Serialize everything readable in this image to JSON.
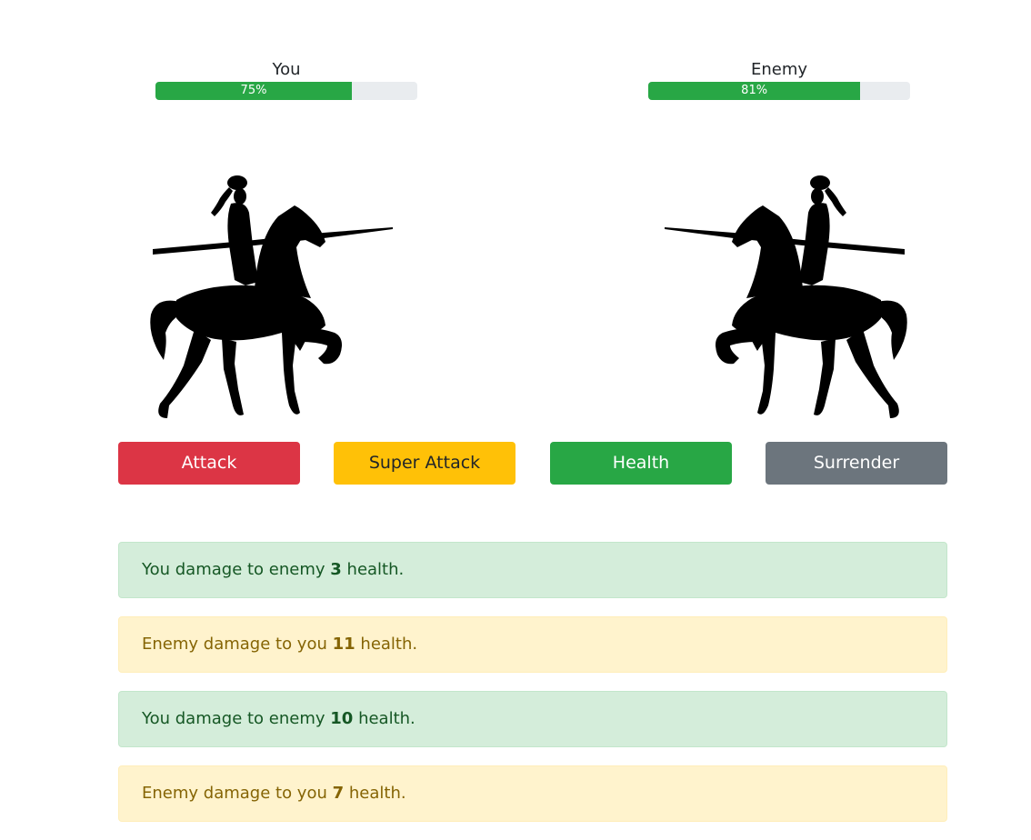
{
  "colors": {
    "bar_fill": "#28a745",
    "bar_track": "#e9ecef",
    "attack": "#dc3545",
    "super_attack": "#ffc107",
    "health": "#28a745",
    "surrender": "#6c757d",
    "log_player_bg": "#d4edda",
    "log_player_border": "#c3e6cb",
    "log_player_text": "#155724",
    "log_enemy_bg": "#fff3cd",
    "log_enemy_border": "#ffeeba",
    "log_enemy_text": "#856404"
  },
  "players": {
    "you": {
      "name": "You",
      "health_percent": 75,
      "health_label": "75%"
    },
    "enemy": {
      "name": "Enemy",
      "health_percent": 81,
      "health_label": "81%"
    }
  },
  "icons": {
    "you": "jousting-knight-icon",
    "enemy": "jousting-knight-icon"
  },
  "controls": {
    "attack": "Attack",
    "super_attack": "Super Attack",
    "health": "Health",
    "surrender": "Surrender"
  },
  "log": [
    {
      "type": "player",
      "prefix": "You damage to enemy",
      "value": "3",
      "suffix": "health."
    },
    {
      "type": "enemy",
      "prefix": "Enemy damage to you",
      "value": "11",
      "suffix": "health."
    },
    {
      "type": "player",
      "prefix": "You damage to enemy",
      "value": "10",
      "suffix": "health."
    },
    {
      "type": "enemy",
      "prefix": "Enemy damage to you",
      "value": "7",
      "suffix": "health."
    }
  ]
}
